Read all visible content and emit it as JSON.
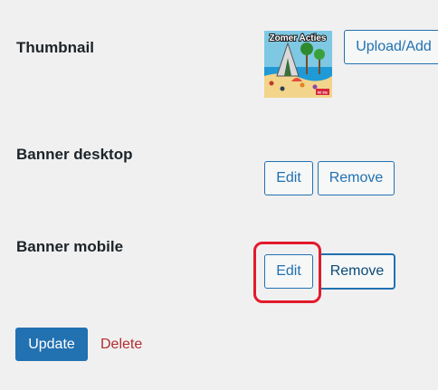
{
  "fields": {
    "thumbnail": {
      "label": "Thumbnail",
      "upload_button": "Upload/Add",
      "image_text": "Zomer Acties",
      "image_badge": "€€ 9te"
    },
    "banner_desktop": {
      "label": "Banner desktop",
      "edit_button": "Edit",
      "remove_button": "Remove"
    },
    "banner_mobile": {
      "label": "Banner mobile",
      "edit_button": "Edit",
      "remove_button": "Remove"
    }
  },
  "actions": {
    "update_button": "Update",
    "delete_link": "Delete"
  },
  "colors": {
    "background": "#f0f0f1",
    "accent": "#2271b1",
    "delete": "#b32d2e",
    "highlight": "#e21b2b"
  }
}
